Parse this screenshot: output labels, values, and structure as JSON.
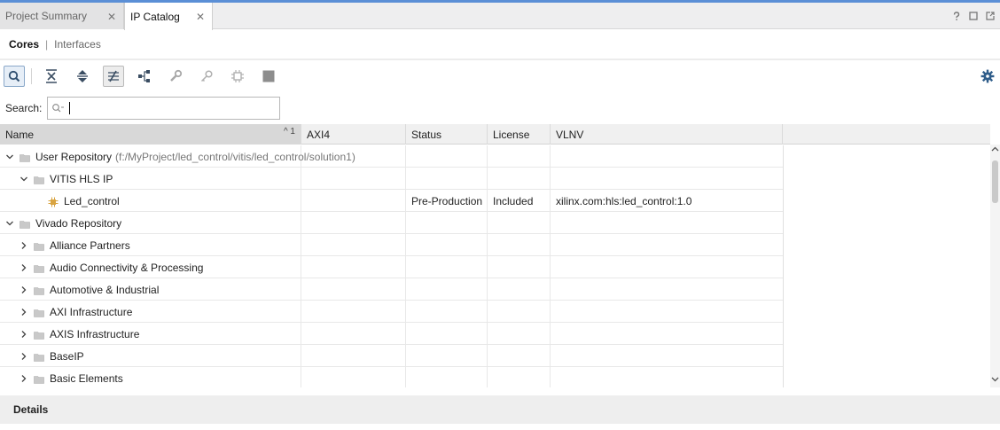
{
  "tabs": [
    {
      "label": "Project Summary",
      "active": false
    },
    {
      "label": "IP Catalog",
      "active": true
    }
  ],
  "window_icons": [
    "help-icon",
    "maximize-icon",
    "float-icon"
  ],
  "subtabs": {
    "cores": "Cores",
    "separator": "|",
    "interfaces": "Interfaces"
  },
  "toolbar": {
    "buttons": [
      "search-icon",
      "collapse-all-icon",
      "expand-all-icon",
      "filter-icon",
      "hierarchy-icon",
      "customize-ip-icon",
      "license-key-icon",
      "chip-icon",
      "stop-icon"
    ],
    "settings": "gear-icon"
  },
  "search": {
    "label": "Search:",
    "value": "",
    "icon": "search-filter-icon"
  },
  "columns": {
    "name": "Name",
    "axi4": "AXI4",
    "status": "Status",
    "license": "License",
    "vlnv": "VLNV",
    "sort_indicator": "^ 1"
  },
  "rows": [
    {
      "level": 0,
      "expanded": true,
      "name": "User Repository",
      "path": "(f:/MyProject/led_control/vitis/led_control/solution1)",
      "axi4": "",
      "status": "",
      "license": "",
      "vlnv": ""
    },
    {
      "level": 1,
      "expanded": true,
      "name": "VITIS HLS IP",
      "path": "",
      "axi4": "",
      "status": "",
      "license": "",
      "vlnv": ""
    },
    {
      "level": 2,
      "leaf": true,
      "name": "Led_control",
      "path": "",
      "axi4": "",
      "status": "Pre-Production",
      "license": "Included",
      "vlnv": "xilinx.com:hls:led_control:1.0"
    },
    {
      "level": 0,
      "expanded": true,
      "name": "Vivado Repository",
      "path": "",
      "axi4": "",
      "status": "",
      "license": "",
      "vlnv": ""
    },
    {
      "level": 1,
      "expanded": false,
      "name": "Alliance Partners",
      "path": "",
      "axi4": "",
      "status": "",
      "license": "",
      "vlnv": ""
    },
    {
      "level": 1,
      "expanded": false,
      "name": "Audio Connectivity & Processing",
      "path": "",
      "axi4": "",
      "status": "",
      "license": "",
      "vlnv": ""
    },
    {
      "level": 1,
      "expanded": false,
      "name": "Automotive & Industrial",
      "path": "",
      "axi4": "",
      "status": "",
      "license": "",
      "vlnv": ""
    },
    {
      "level": 1,
      "expanded": false,
      "name": "AXI Infrastructure",
      "path": "",
      "axi4": "",
      "status": "",
      "license": "",
      "vlnv": ""
    },
    {
      "level": 1,
      "expanded": false,
      "name": "AXIS Infrastructure",
      "path": "",
      "axi4": "",
      "status": "",
      "license": "",
      "vlnv": ""
    },
    {
      "level": 1,
      "expanded": false,
      "name": "BaseIP",
      "path": "",
      "axi4": "",
      "status": "",
      "license": "",
      "vlnv": ""
    },
    {
      "level": 1,
      "expanded": false,
      "name": "Basic Elements",
      "path": "",
      "axi4": "",
      "status": "",
      "license": "",
      "vlnv": ""
    }
  ],
  "details": {
    "label": "Details"
  },
  "colors": {
    "accent": "#5b8fd6",
    "folder": "#c9c9c9",
    "ip_icon": "#d9a441"
  }
}
